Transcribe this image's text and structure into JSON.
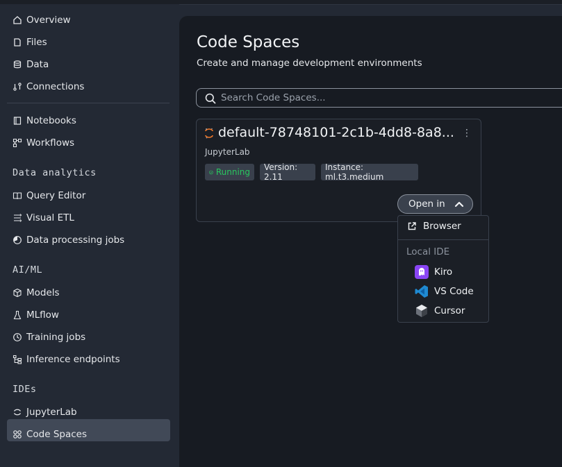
{
  "sidebar": {
    "items_top": [
      {
        "label": "Overview",
        "icon": "home-icon"
      },
      {
        "label": "Files",
        "icon": "file-icon"
      },
      {
        "label": "Data",
        "icon": "database-icon"
      },
      {
        "label": "Connections",
        "icon": "connections-icon"
      }
    ],
    "items_mid": [
      {
        "label": "Notebooks",
        "icon": "notebook-icon"
      },
      {
        "label": "Workflows",
        "icon": "workflow-icon"
      }
    ],
    "sections": [
      {
        "title": "Data analytics",
        "items": [
          {
            "label": "Query Editor",
            "icon": "book-icon"
          },
          {
            "label": "Visual ETL",
            "icon": "etl-icon"
          },
          {
            "label": "Data processing jobs",
            "icon": "pie-icon"
          }
        ]
      },
      {
        "title": "AI/ML",
        "items": [
          {
            "label": "Models",
            "icon": "cube-icon"
          },
          {
            "label": "MLflow",
            "icon": "flask-icon"
          },
          {
            "label": "Training jobs",
            "icon": "clock-icon"
          },
          {
            "label": "Inference endpoints",
            "icon": "tree-icon"
          }
        ]
      },
      {
        "title": "IDEs",
        "items": [
          {
            "label": "JupyterLab",
            "icon": "jupyter-icon"
          },
          {
            "label": "Code Spaces",
            "icon": "grid-icon",
            "active": true
          }
        ]
      }
    ]
  },
  "main": {
    "title": "Code Spaces",
    "subtitle": "Create and manage development environments",
    "search_placeholder": "Search Code Spaces..."
  },
  "card": {
    "title": "default-78748101-2c1b-4dd8-8a8...",
    "subtitle": "JupyterLab",
    "status": "Running",
    "status_color": "#29c75f",
    "version": "Version: 2.11",
    "instance": "Instance: ml.t3.medium",
    "open_label": "Open in"
  },
  "dropdown": {
    "browser_label": "Browser",
    "group_label": "Local IDE",
    "ides": [
      {
        "label": "Kiro",
        "icon": "kiro-icon",
        "color": "#8a45f5"
      },
      {
        "label": "VS Code",
        "icon": "vscode-icon",
        "color": "#1f8ad2"
      },
      {
        "label": "Cursor",
        "icon": "cursor-icon",
        "color": "#cfd3d8"
      }
    ]
  }
}
